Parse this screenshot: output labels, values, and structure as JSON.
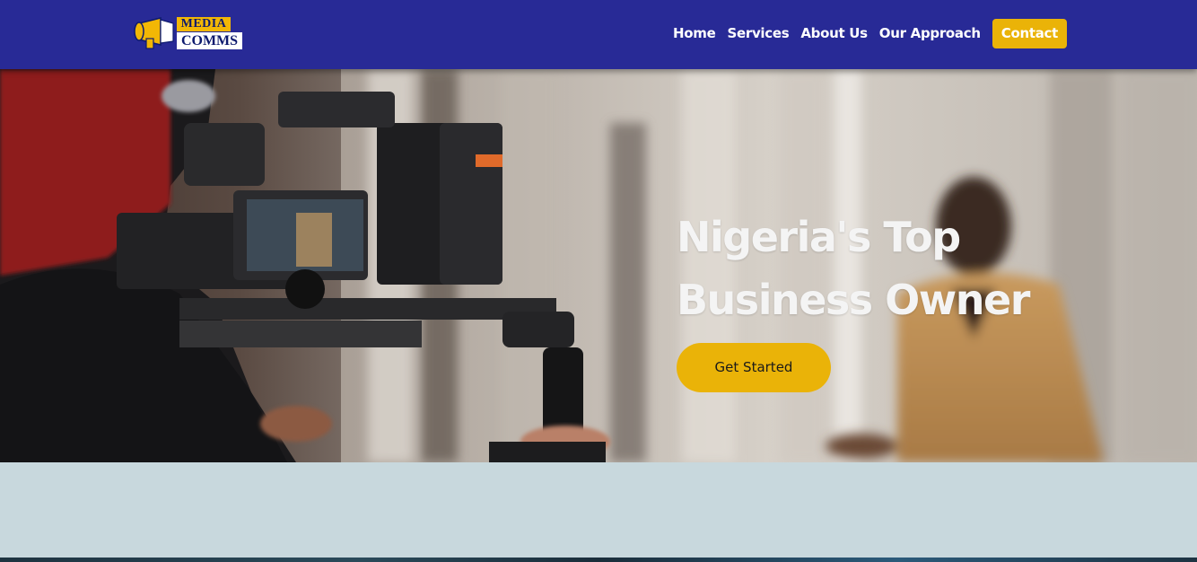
{
  "nav": {
    "logo": {
      "line1": "MEDIA",
      "line2": "COMMS"
    },
    "links": [
      "Home",
      "Services",
      "About Us",
      "Our Approach"
    ],
    "contact_label": "Contact"
  },
  "hero": {
    "title_line1": "Nigeria's Top",
    "title_line2": "Business Owner",
    "cta_label": "Get Started"
  },
  "colors": {
    "nav_bg": "#282a96",
    "accent": "#eab308",
    "below_bg": "#c8d8dd"
  }
}
